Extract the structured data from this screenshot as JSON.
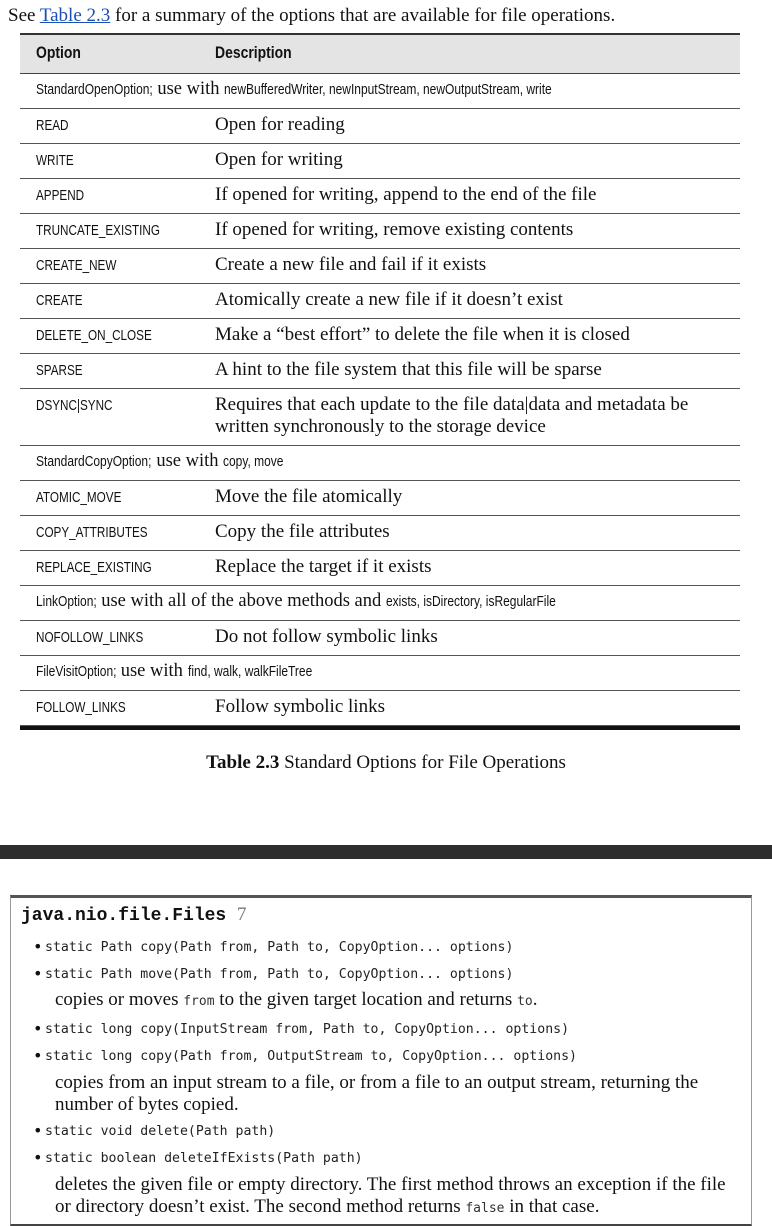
{
  "intro": {
    "pre": "See ",
    "link": "Table 2.3",
    "post": " for a summary of the options that are available for file operations."
  },
  "table": {
    "header": {
      "option": "Option",
      "description": "Description"
    },
    "rows": [
      {
        "kind": "group",
        "code1": "StandardOpenOption;",
        "text1": " use with ",
        "code2": "newBufferedWriter, newInputStream, newOutputStream, write"
      },
      {
        "kind": "opt",
        "option": "READ",
        "description": "Open for reading"
      },
      {
        "kind": "opt",
        "option": "WRITE",
        "description": "Open for writing"
      },
      {
        "kind": "opt",
        "option": "APPEND",
        "description": "If opened for writing, append to the end of the file"
      },
      {
        "kind": "opt",
        "option": "TRUNCATE_EXISTING",
        "description": "If opened for writing, remove existing contents"
      },
      {
        "kind": "opt",
        "option": "CREATE_NEW",
        "description": "Create a new file and fail if it exists"
      },
      {
        "kind": "opt",
        "option": "CREATE",
        "description": "Atomically create a new file if it doesn’t exist"
      },
      {
        "kind": "opt",
        "option": "DELETE_ON_CLOSE",
        "description": "Make a “best effort” to delete the file when it is closed"
      },
      {
        "kind": "opt",
        "option": "SPARSE",
        "description": "A hint to the file system that this file will be sparse"
      },
      {
        "kind": "opt2",
        "option": "DSYNC|SYNC",
        "description": "Requires that each update to the file data|data and metadata be written synchronously to the storage device"
      },
      {
        "kind": "group",
        "code1": "StandardCopyOption;",
        "text1": " use with ",
        "code2": "copy, move"
      },
      {
        "kind": "opt",
        "option": "ATOMIC_MOVE",
        "description": "Move the file atomically"
      },
      {
        "kind": "opt",
        "option": "COPY_ATTRIBUTES",
        "description": "Copy the file attributes"
      },
      {
        "kind": "opt",
        "option": "REPLACE_EXISTING",
        "description": "Replace the target if it exists"
      },
      {
        "kind": "group",
        "code1": "LinkOption;",
        "text1": " use with all of the above methods and ",
        "code2": "exists, isDirectory, isRegularFile"
      },
      {
        "kind": "opt",
        "option": "NOFOLLOW_LINKS",
        "description": "Do not follow symbolic links"
      },
      {
        "kind": "group",
        "code1": "FileVisitOption;",
        "text1": " use with ",
        "code2": "find, walk, walkFileTree"
      },
      {
        "kind": "opt",
        "option": "FOLLOW_LINKS",
        "description": "Follow symbolic links"
      }
    ]
  },
  "caption": {
    "label": "Table 2.3",
    "text": " Standard Options for File Operations"
  },
  "api": {
    "class_name": "java.nio.file.Files",
    "version": "7",
    "methods": [
      "static Path copy(Path from, Path to, CopyOption... options)",
      "static Path move(Path from, Path to, CopyOption... options)",
      "static long copy(InputStream from, Path to, CopyOption... options)",
      "static long copy(Path from, OutputStream to, CopyOption... options)",
      "static void delete(Path path)",
      "static boolean deleteIfExists(Path path)"
    ],
    "desc1": {
      "a": "copies or moves ",
      "code1": "from",
      "b": " to the given target location and returns ",
      "code2": "to",
      "c": "."
    },
    "desc2": "copies from an input stream to a file, or from a file to an output stream, returning the number of bytes copied.",
    "desc3": {
      "a": "deletes the given file or empty directory. The first method throws an exception if the file or directory doesn’t exist. The second method returns ",
      "code": "false",
      "b": " in that case."
    }
  }
}
